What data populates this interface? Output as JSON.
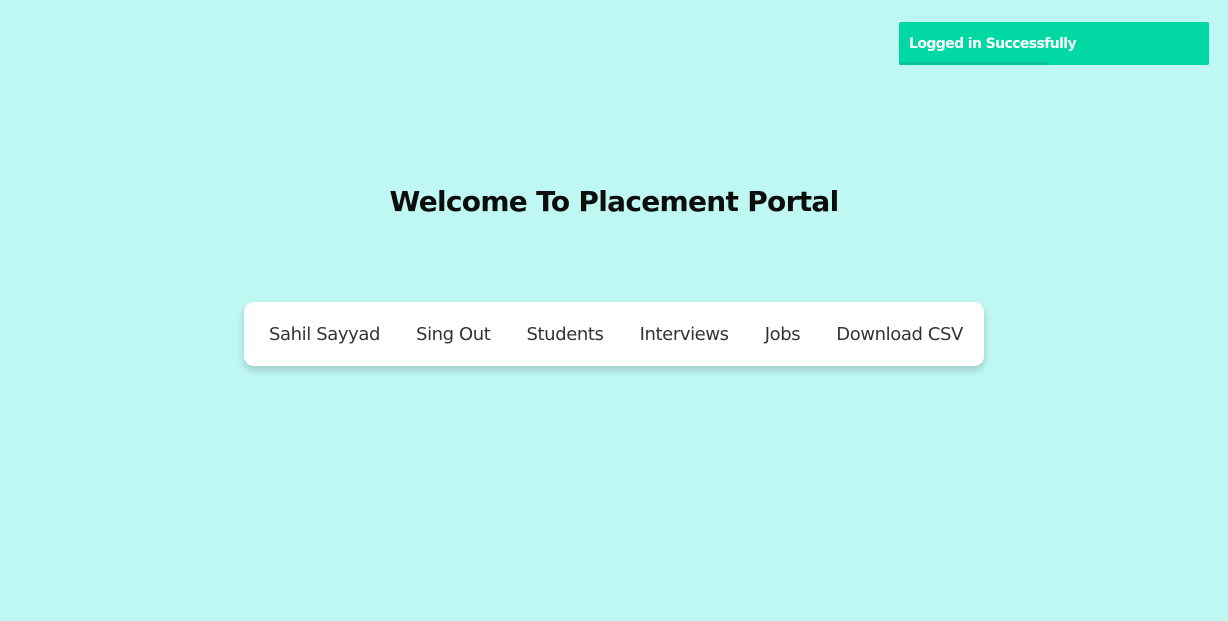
{
  "toast": {
    "message": "Logged in Successfully",
    "background_color": "#02d8a3",
    "progress_color": "#0bc496",
    "progress_remaining": 0.48
  },
  "page": {
    "title": "Welcome To Placement Portal",
    "background_color": "#bff7f3"
  },
  "nav": {
    "items": [
      {
        "label": "Sahil Sayyad"
      },
      {
        "label": "Sing Out"
      },
      {
        "label": "Students"
      },
      {
        "label": "Interviews"
      },
      {
        "label": "Jobs"
      },
      {
        "label": "Download CSV"
      }
    ]
  }
}
